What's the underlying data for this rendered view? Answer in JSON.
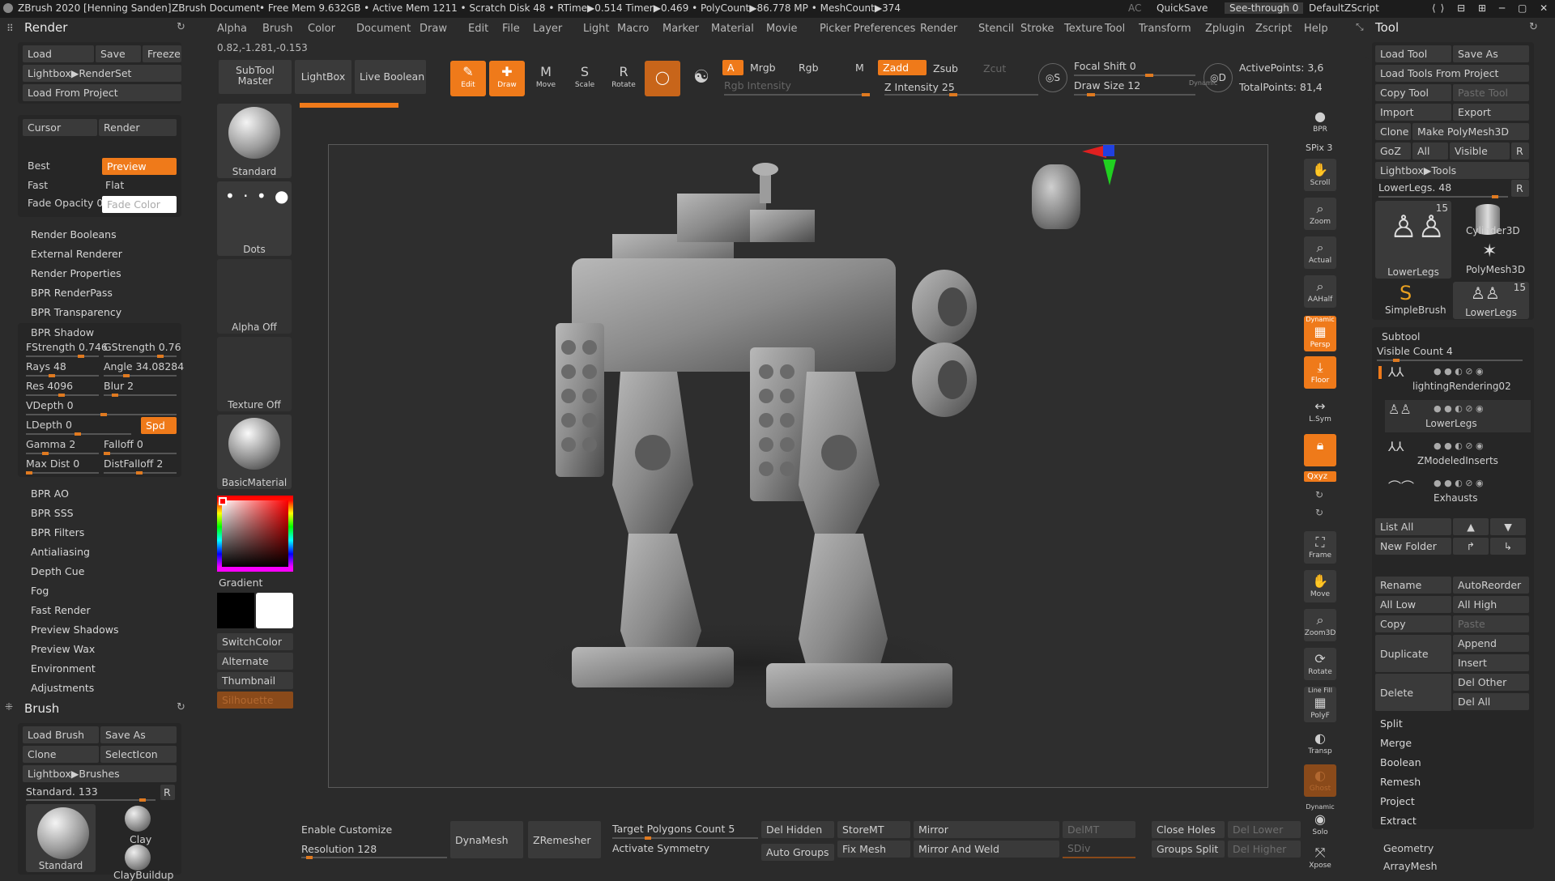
{
  "titlebar": {
    "app": "ZBrush 2020 [Henning Sanden]",
    "doc": "ZBrush Document",
    "stats": "• Free Mem 9.632GB • Active Mem 1211 • Scratch Disk 48 • RTime▶0.514 Timer▶0.469 • PolyCount▶86.778 MP • MeshCount▶374",
    "ac": "AC",
    "quicksave": "QuickSave",
    "seethrough": "See-through",
    "seethrough_val": "0",
    "script": "DefaultZScript"
  },
  "menu": [
    "Alpha",
    "Brush",
    "Color",
    "Document",
    "Draw",
    "Edit",
    "File",
    "Layer",
    "Light",
    "Macro",
    "Marker",
    "Material",
    "Movie",
    "Picker",
    "Preferences",
    "Render",
    "Stencil",
    "Stroke",
    "Texture",
    "Tool",
    "Transform",
    "Zplugin",
    "Zscript",
    "Help"
  ],
  "coords": "0.82,-1.281,-0.153",
  "render": {
    "title": "Render",
    "load": "Load",
    "save": "Save",
    "freeze": "Freeze",
    "lightbox": "Lightbox▶RenderSet",
    "load_project": "Load From Project",
    "cursor": "Cursor",
    "render_btn": "Render",
    "best": "Best",
    "preview": "Preview",
    "fast": "Fast",
    "flat": "Flat",
    "fade_opacity": "Fade Opacity 0",
    "fade_color": "Fade Color",
    "items": [
      "Render Booleans",
      "External Renderer",
      "Render Properties",
      "BPR RenderPass",
      "BPR Transparency"
    ],
    "shadow_title": "BPR Shadow",
    "fstrength": "FStrength 0.746",
    "gstrength": "GStrength 0.76",
    "rays": "Rays 48",
    "angle": "Angle 34.08284",
    "res": "Res 4096",
    "blur": "Blur 2",
    "vdepth": "VDepth 0",
    "ldepth": "LDepth 0",
    "spd": "Spd",
    "gamma": "Gamma 2",
    "falloff": "Falloff 0",
    "maxdist": "Max Dist 0",
    "distfalloff": "DistFalloff 2",
    "items2": [
      "BPR AO",
      "BPR SSS",
      "BPR Filters",
      "Antialiasing",
      "Depth Cue",
      "Fog",
      "Fast Render",
      "Preview Shadows",
      "Preview Wax",
      "Environment",
      "Adjustments"
    ]
  },
  "brush": {
    "title": "Brush",
    "load": "Load Brush",
    "save": "Save As",
    "clone": "Clone",
    "selecticon": "SelectIcon",
    "lightbox": "Lightbox▶Brushes",
    "standard": "Standard. 133",
    "r": "R",
    "thumbs": [
      "Standard",
      "Clay",
      "ClayBuildup"
    ]
  },
  "shelf": {
    "subtool_master": "SubTool Master",
    "lightbox": "LightBox",
    "live_boolean": "Live Boolean",
    "edit": "Edit",
    "draw": "Draw",
    "move": "Move",
    "scale": "Scale",
    "rotate": "Rotate",
    "a": "A",
    "mrgb": "Mrgb",
    "rgb": "Rgb",
    "m": "M",
    "rgb_intensity": "Rgb Intensity",
    "zadd": "Zadd",
    "zsub": "Zsub",
    "zcut": "Zcut",
    "z_intensity": "Z Intensity 25",
    "focal_shift": "Focal Shift 0",
    "draw_size": "Draw Size 12",
    "dynamic": "Dynamic",
    "active_points": "ActivePoints: 3,6",
    "total_points": "TotalPoints: 81,4"
  },
  "leftshelf": {
    "standard": "Standard",
    "dots": "Dots",
    "alpha": "Alpha Off",
    "texture": "Texture Off",
    "material": "BasicMaterial",
    "gradient": "Gradient",
    "switchcolor": "SwitchColor",
    "alternate": "Alternate",
    "thumbnail": "Thumbnail",
    "silhouette": "Silhouette"
  },
  "rightshelf": {
    "bpr": "BPR",
    "spix": "SPix 3",
    "scroll": "Scroll",
    "zoom": "Zoom",
    "actual": "Actual",
    "aahalf": "AAHalf",
    "dynamic": "Dynamic",
    "persp": "Persp",
    "floor": "Floor",
    "lsym": "L.Sym",
    "xyz": "Qxyz",
    "frame": "Frame",
    "move": "Move",
    "zoom3d": "Zoom3D",
    "rotate": "Rotate",
    "linefill": "Line Fill",
    "polyf": "PolyF",
    "transp": "Transp",
    "ghost": "Ghost",
    "dynamic2": "Dynamic",
    "solo": "Solo",
    "xpose": "Xpose"
  },
  "bottom": {
    "enable_customize": "Enable Customize",
    "resolution": "Resolution 128",
    "dynamesh": "DynaMesh",
    "zremesher": "ZRemesher",
    "target_poly": "Target Polygons Count 5",
    "activate_sym": "Activate Symmetry",
    "del_hidden": "Del Hidden",
    "auto_groups": "Auto Groups",
    "storemt": "StoreMT",
    "fix_mesh": "Fix Mesh",
    "mirror": "Mirror",
    "mirror_weld": "Mirror And Weld",
    "delmt": "DelMT",
    "sdiv": "SDiv",
    "close_holes": "Close Holes",
    "groups_split": "Groups Split",
    "del_lower": "Del Lower",
    "del_higher": "Del Higher"
  },
  "tool": {
    "title": "Tool",
    "load": "Load Tool",
    "save": "Save As",
    "load_project": "Load Tools From Project",
    "copy": "Copy Tool",
    "paste": "Paste Tool",
    "import": "Import",
    "export": "Export",
    "clone": "Clone",
    "make_poly": "Make PolyMesh3D",
    "goz": "GoZ",
    "all": "All",
    "visible": "Visible",
    "r": "R",
    "lightbox": "Lightbox▶Tools",
    "lowerlegs": "LowerLegs. 48",
    "thumbs": [
      "LowerLegs",
      "Cylinder3D",
      "PolyMesh3D",
      "SimpleBrush",
      "LowerLegs"
    ],
    "thumb_count": "15",
    "subtool_title": "Subtool",
    "visible_count": "Visible Count 4",
    "subtools": [
      "lightingRendering02",
      "LowerLegs",
      "ZModeledInserts",
      "Exhausts"
    ],
    "list_all": "List All",
    "new_folder": "New Folder",
    "rename": "Rename",
    "autoreorder": "AutoReorder",
    "all_low": "All Low",
    "all_high": "All High",
    "copy2": "Copy",
    "paste2": "Paste",
    "duplicate": "Duplicate",
    "append": "Append",
    "insert": "Insert",
    "delete": "Delete",
    "del_other": "Del Other",
    "del_all": "Del All",
    "items": [
      "Split",
      "Merge",
      "Boolean",
      "Remesh",
      "Project",
      "Extract"
    ],
    "geometry": "Geometry",
    "arraymesh": "ArrayMesh"
  }
}
